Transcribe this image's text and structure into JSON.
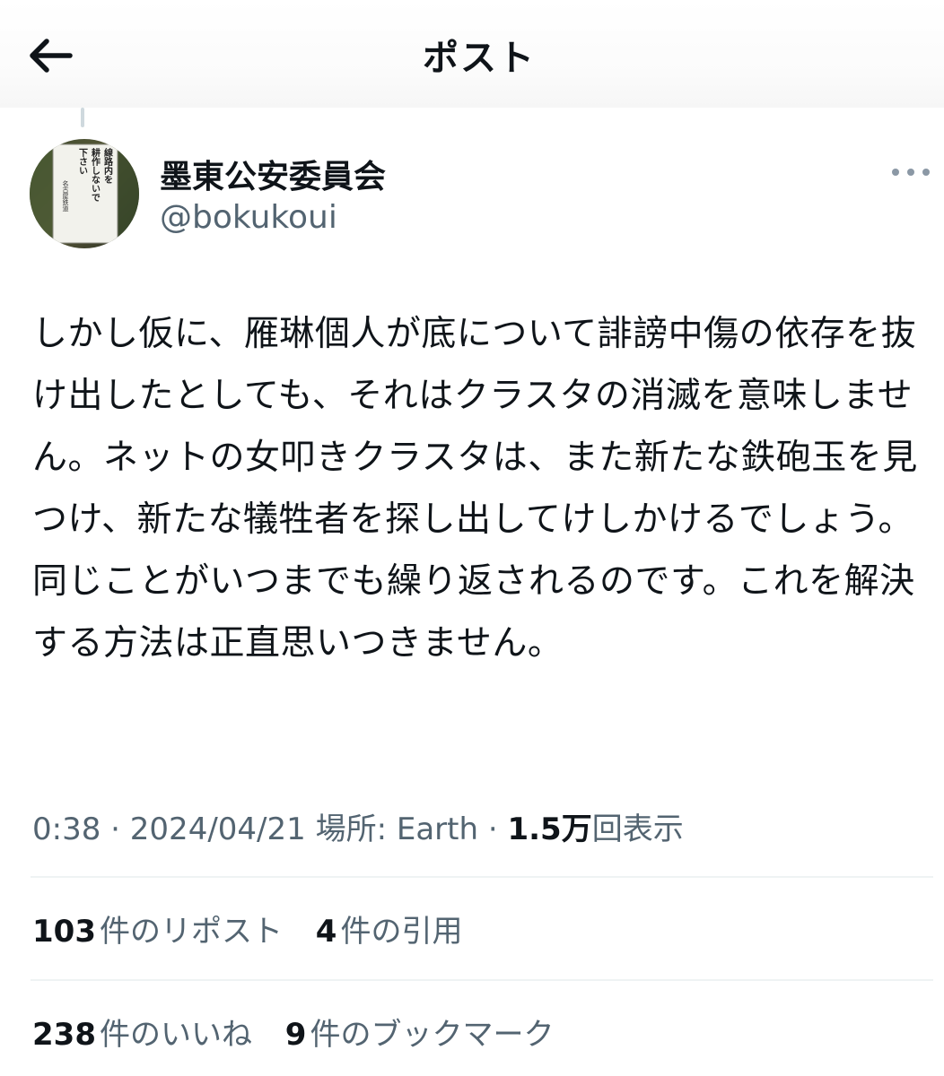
{
  "header": {
    "title": "ポスト",
    "back_icon": "arrow-left-icon"
  },
  "post": {
    "author": {
      "display_name": "墨東公安委員会",
      "handle": "@bokukoui",
      "avatar_sign_text": [
        "線路内を",
        "耕作しないで",
        "下さい",
        "名古屋鉄道"
      ]
    },
    "more_icon": "more-dots-icon",
    "text": "しかし仮に、雁琳個人が底について誹謗中傷の依存を抜け出したとしても、それはクラスタの消滅を意味しません。ネットの女叩きクラスタは、また新たな鉄砲玉を見つけ、新たな犠牲者を探し出してけしかけるでしょう。同じことがいつまでも繰り返されるのです。これを解決する方法は正直思いつきません。",
    "meta": {
      "time": "0:38",
      "separator": "·",
      "date": "2024/04/21",
      "location": "場所: Earth",
      "views_count": "1.5万",
      "views_label": "回表示"
    },
    "stats": {
      "reposts_count": "103",
      "reposts_label": "件のリポスト",
      "quotes_count": "4",
      "quotes_label": "件の引用",
      "likes_count": "238",
      "likes_label": "件のいいね",
      "bookmarks_count": "9",
      "bookmarks_label": "件のブックマーク"
    }
  },
  "colors": {
    "text_primary": "#0f1419",
    "text_secondary": "#536471",
    "divider": "#eff3f4"
  }
}
